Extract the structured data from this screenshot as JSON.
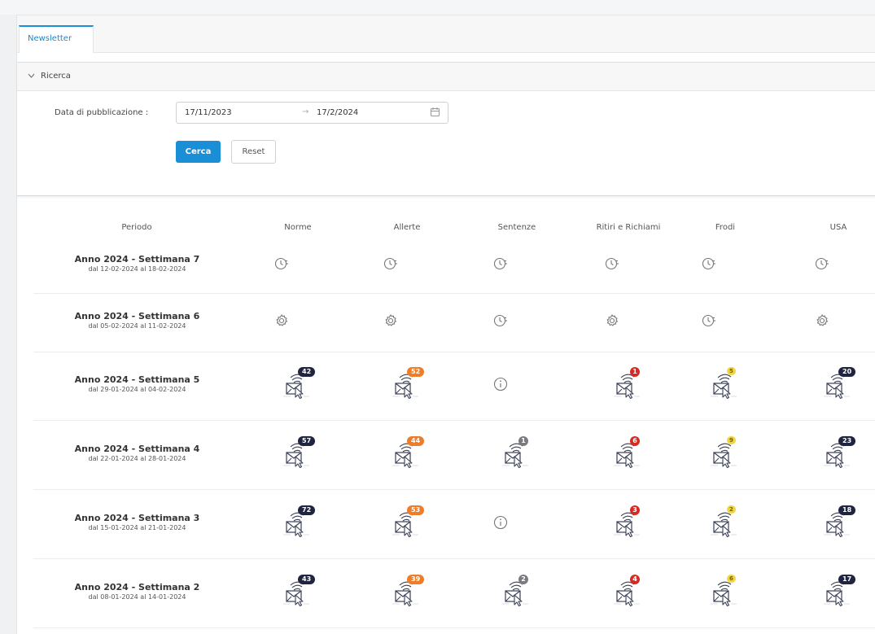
{
  "tabs": [
    {
      "label": "Newsletter"
    }
  ],
  "search": {
    "section_label": "Ricerca",
    "date_label": "Data di pubblicazione :",
    "date_from": "17/11/2023",
    "date_to": "17/2/2024",
    "search_button": "Cerca",
    "reset_button": "Reset"
  },
  "table": {
    "headers": [
      "Periodo",
      "Norme",
      "Allerte",
      "Sentenze",
      "Ritiri e Richiami",
      "Frodi",
      "USA"
    ],
    "rows": [
      {
        "title": "Anno 2024 - Settimana 7",
        "dates": "dal 12-02-2024 al 18-02-2024",
        "cells": [
          {
            "state": "clock"
          },
          {
            "state": "clock"
          },
          {
            "state": "clock"
          },
          {
            "state": "clock"
          },
          {
            "state": "clock"
          },
          {
            "state": "clock"
          }
        ]
      },
      {
        "title": "Anno 2024 - Settimana 6",
        "dates": "dal 05-02-2024 al 11-02-2024",
        "cells": [
          {
            "state": "gear"
          },
          {
            "state": "gear"
          },
          {
            "state": "clock"
          },
          {
            "state": "gear"
          },
          {
            "state": "clock"
          },
          {
            "state": "gear"
          }
        ]
      },
      {
        "title": "Anno 2024 - Settimana 5",
        "dates": "dal 29-01-2024 al 04-02-2024",
        "cells": [
          {
            "state": "mail",
            "count": "42",
            "color": "dark"
          },
          {
            "state": "mail",
            "count": "52",
            "color": "orange"
          },
          {
            "state": "info"
          },
          {
            "state": "mail",
            "count": "1",
            "color": "red"
          },
          {
            "state": "mail",
            "count": "5",
            "color": "yellow"
          },
          {
            "state": "mail",
            "count": "20",
            "color": "dark"
          }
        ]
      },
      {
        "title": "Anno 2024 - Settimana 4",
        "dates": "dal 22-01-2024 al 28-01-2024",
        "cells": [
          {
            "state": "mail",
            "count": "57",
            "color": "dark"
          },
          {
            "state": "mail",
            "count": "44",
            "color": "orange"
          },
          {
            "state": "mail",
            "count": "1",
            "color": "gray"
          },
          {
            "state": "mail",
            "count": "6",
            "color": "red"
          },
          {
            "state": "mail",
            "count": "9",
            "color": "yellow"
          },
          {
            "state": "mail",
            "count": "23",
            "color": "dark"
          }
        ]
      },
      {
        "title": "Anno 2024 - Settimana 3",
        "dates": "dal 15-01-2024 al 21-01-2024",
        "cells": [
          {
            "state": "mail",
            "count": "72",
            "color": "dark"
          },
          {
            "state": "mail",
            "count": "53",
            "color": "orange"
          },
          {
            "state": "info"
          },
          {
            "state": "mail",
            "count": "3",
            "color": "red"
          },
          {
            "state": "mail",
            "count": "2",
            "color": "yellow"
          },
          {
            "state": "mail",
            "count": "18",
            "color": "dark"
          }
        ]
      },
      {
        "title": "Anno 2024 - Settimana 2",
        "dates": "dal 08-01-2024 al 14-01-2024",
        "cells": [
          {
            "state": "mail",
            "count": "43",
            "color": "dark"
          },
          {
            "state": "mail",
            "count": "39",
            "color": "orange"
          },
          {
            "state": "mail",
            "count": "2",
            "color": "gray"
          },
          {
            "state": "mail",
            "count": "4",
            "color": "red"
          },
          {
            "state": "mail",
            "count": "6",
            "color": "yellow"
          },
          {
            "state": "mail",
            "count": "17",
            "color": "dark"
          }
        ]
      }
    ]
  },
  "colors": {
    "accent": "#1a8fd8",
    "badge_dark": "#1f2540",
    "badge_orange": "#ee7d2a",
    "badge_red": "#d82a24",
    "badge_yellow": "#f0d545",
    "badge_gray": "#7a7b80"
  },
  "icons": {
    "clock": "clock-icon",
    "gear": "gear-icon",
    "info": "info-icon",
    "mail": "newsletter-mail-icon"
  }
}
